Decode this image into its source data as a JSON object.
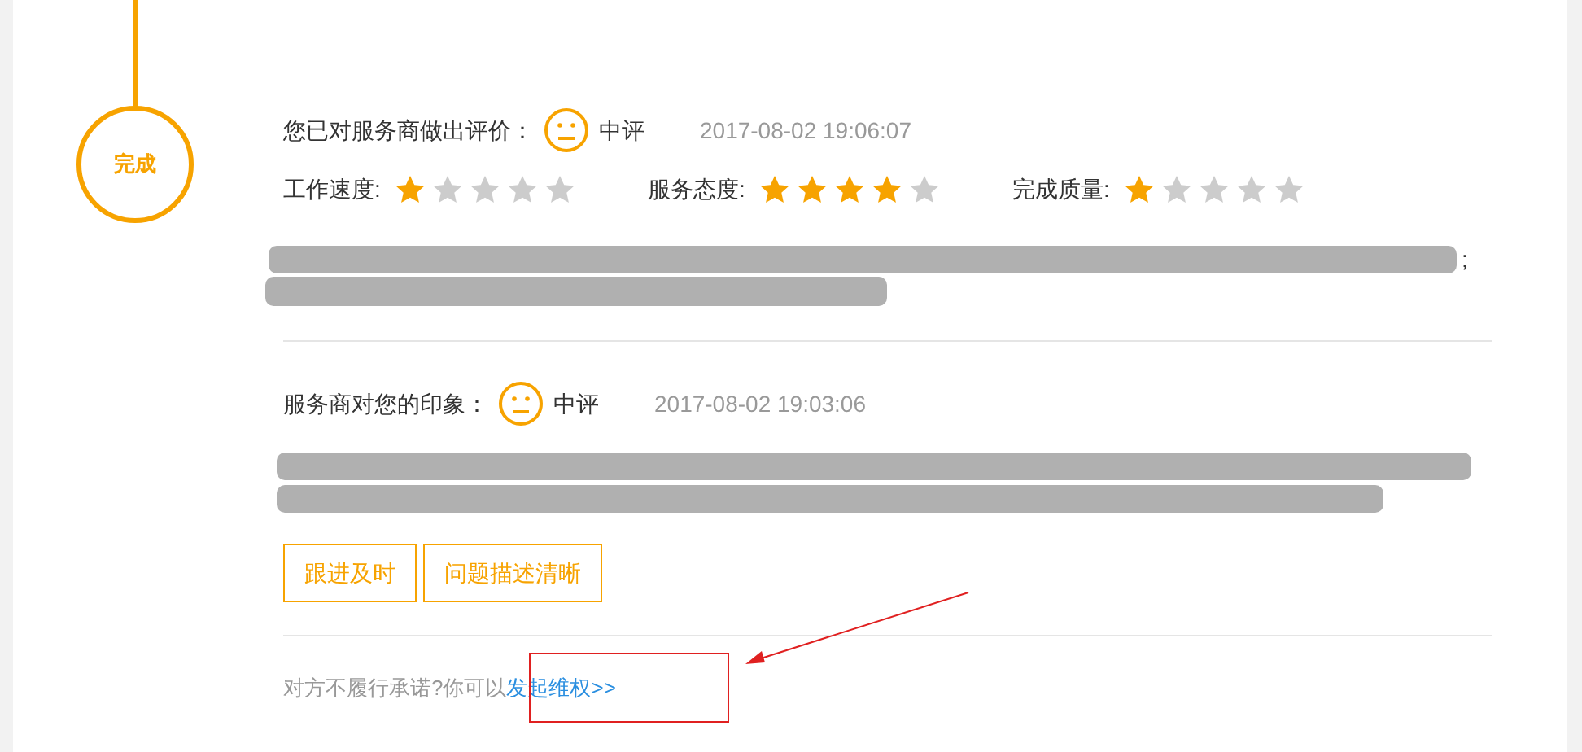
{
  "timeline": {
    "step": "完成"
  },
  "my_review": {
    "label": "您已对服务商做出评价：",
    "rating": "中评",
    "time": "2017-08-02 19:06:07",
    "scores": [
      {
        "label": "工作速度:",
        "stars": 1
      },
      {
        "label": "服务态度:",
        "stars": 4
      },
      {
        "label": "完成质量:",
        "stars": 1
      }
    ],
    "trailing": ";"
  },
  "provider_review": {
    "label": "服务商对您的印象：",
    "rating": "中评",
    "time": "2017-08-02 19:03:06",
    "tags": [
      "跟进及时",
      "问题描述清晰"
    ]
  },
  "footer": {
    "text": "对方不履行承诺?你可以",
    "link": "发起维权>>"
  }
}
